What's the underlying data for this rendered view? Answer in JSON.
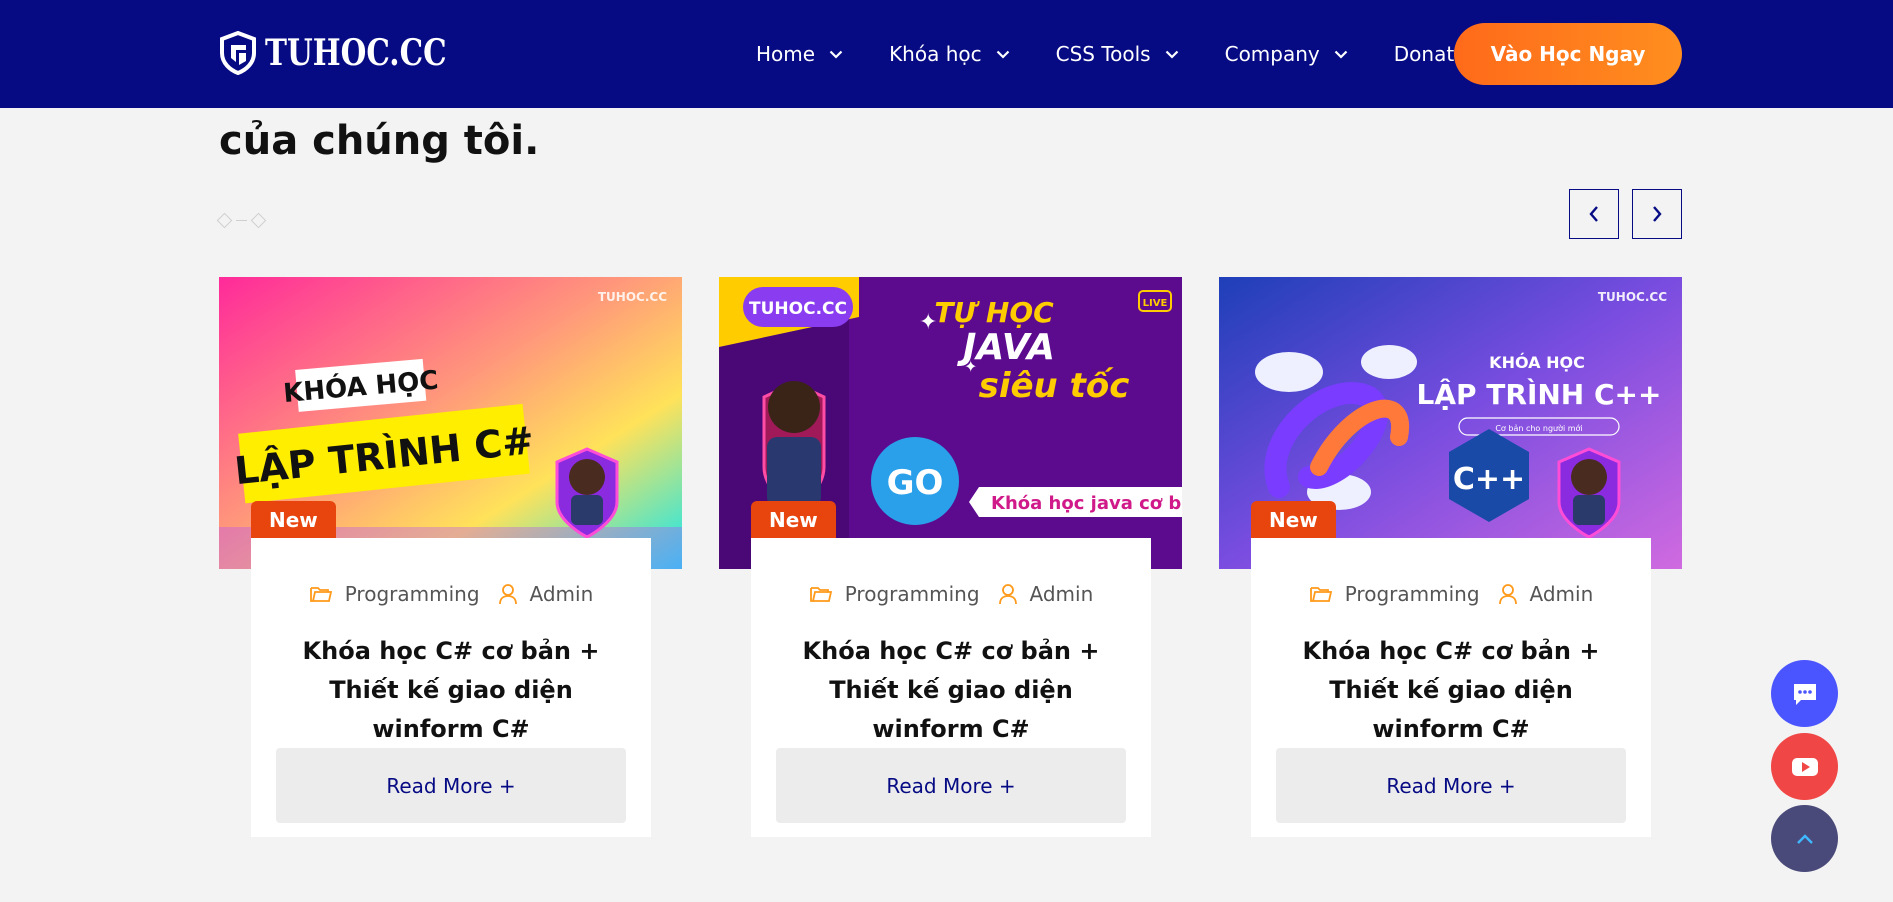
{
  "header": {
    "logo_text": "TUHOC.CC",
    "nav": [
      {
        "label": "Home",
        "has_dropdown": true
      },
      {
        "label": "Khóa học",
        "has_dropdown": true
      },
      {
        "label": "CSS Tools",
        "has_dropdown": true
      },
      {
        "label": "Company",
        "has_dropdown": true
      },
      {
        "label": "Donate Us",
        "has_dropdown": false
      }
    ],
    "cta_label": "Vào Học Ngay"
  },
  "section": {
    "title": "của chúng tôi."
  },
  "cards": [
    {
      "badge": "New",
      "category": "Programming",
      "author": "Admin",
      "title": "Khóa học C# cơ bản + Thiết kế giao diện winform C#",
      "read_more": "Read More +",
      "thumbnail": {
        "watermark": "TUHOC.CC",
        "line1": "KHÓA HỌC",
        "line2": "LẬP TRÌNH C#"
      }
    },
    {
      "badge": "New",
      "category": "Programming",
      "author": "Admin",
      "title": "Khóa học C# cơ bản + Thiết kế giao diện winform C#",
      "read_more": "Read More +",
      "thumbnail": {
        "watermark": "TUHOC.CC",
        "live": "LIVE",
        "line1": "TỰ HỌC",
        "line2": "JAVA",
        "line3": "siêu tốc",
        "go": "GO",
        "ribbon": "Khóa học java cơ bản"
      }
    },
    {
      "badge": "New",
      "category": "Programming",
      "author": "Admin",
      "title": "Khóa học C# cơ bản + Thiết kế giao diện winform C#",
      "read_more": "Read More +",
      "thumbnail": {
        "watermark": "TUHOC.CC",
        "line1": "KHÓA HỌC",
        "line2": "LẬP TRÌNH C++",
        "pill": "Cơ bản cho người mới",
        "cpp": "C++"
      }
    }
  ],
  "colors": {
    "header_bg": "#060b84",
    "cta": "#ff7a1a",
    "badge": "#e7450d",
    "chat_button": "#4a55ff",
    "youtube_button": "#f04646",
    "scroll_top_button": "#4a4a7a"
  },
  "floating": {
    "chat_icon": "chat-icon",
    "youtube_icon": "youtube-icon",
    "scroll_top_icon": "chevron-up-icon"
  }
}
